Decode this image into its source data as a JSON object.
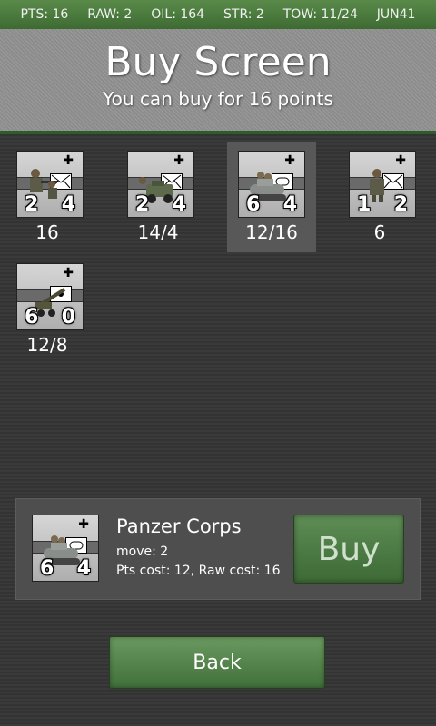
{
  "status": {
    "pts": "PTS: 16",
    "raw": "RAW: 2",
    "oil": "OIL: 164",
    "str": "STR: 2",
    "tow": "TOW: 11/24",
    "date": "JUN41"
  },
  "header": {
    "title": "Buy Screen",
    "subtitle": "You can buy for 16 points"
  },
  "units": [
    {
      "name": "infantry-unit",
      "icon": "infantry-icon",
      "attack": "2",
      "defense": "4",
      "cost": "16",
      "symbol": "envelope"
    },
    {
      "name": "truck-unit",
      "icon": "truck-icon",
      "attack": "2",
      "defense": "4",
      "cost": "14/4",
      "symbol": "envelope"
    },
    {
      "name": "panzer-unit",
      "icon": "tank-icon",
      "attack": "6",
      "defense": "4",
      "cost": "12/16",
      "symbol": "tank"
    },
    {
      "name": "recon-unit",
      "icon": "soldier-icon",
      "attack": "1",
      "defense": "2",
      "cost": "6",
      "symbol": "envelope-b"
    },
    {
      "name": "artillery-unit",
      "icon": "artillery-gun-icon",
      "attack": "6",
      "defense": "0",
      "cost": "12/8",
      "symbol": "dot"
    }
  ],
  "selected_index": 2,
  "details": {
    "name": "Panzer Corps",
    "move": "move: 2",
    "costs": "Pts cost: 12, Raw cost: 16",
    "attack": "6",
    "defense": "4",
    "buy_label": "Buy"
  },
  "back_label": "Back",
  "colors": {
    "accent_green": "#3d6b32",
    "background": "#363636",
    "selected": "#585858"
  }
}
